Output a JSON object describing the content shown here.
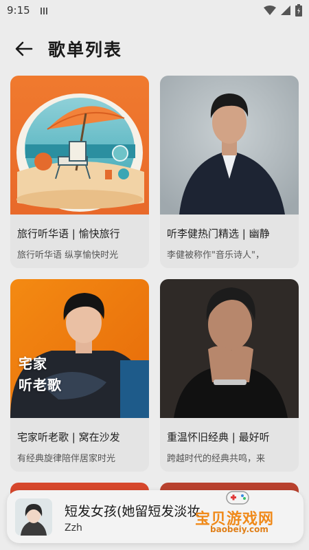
{
  "status": {
    "time": "9:15"
  },
  "header": {
    "title": "歌单列表"
  },
  "cards": [
    {
      "title": "旅行听华语 | 愉快旅行",
      "subtitle": "旅行听华语 纵享愉快时光",
      "cover": "beach-umbrella-illustration"
    },
    {
      "title": "听李健热门精选 | 幽静",
      "subtitle": "李健被称作\"音乐诗人\"，",
      "cover": "man-in-suit-portrait"
    },
    {
      "title": "宅家听老歌 | 窝在沙发",
      "subtitle": "有经典旋律陪伴居家时光",
      "cover": "young-man-orange-background",
      "overlay": [
        "宅家",
        "听老歌"
      ]
    },
    {
      "title": "重温怀旧经典 | 最好听",
      "subtitle": "跨越时代的经典共鸣，来",
      "cover": "older-man-dark-background"
    }
  ],
  "player": {
    "song": "短发女孩(她留短发淡妆",
    "artist": "Zzh"
  },
  "watermark": {
    "text": "宝贝游戏网",
    "url": "baobeiy.com"
  },
  "colors": {
    "background": "#ececec",
    "card": "#e4e4e4",
    "watermark": "#f08a1a"
  }
}
